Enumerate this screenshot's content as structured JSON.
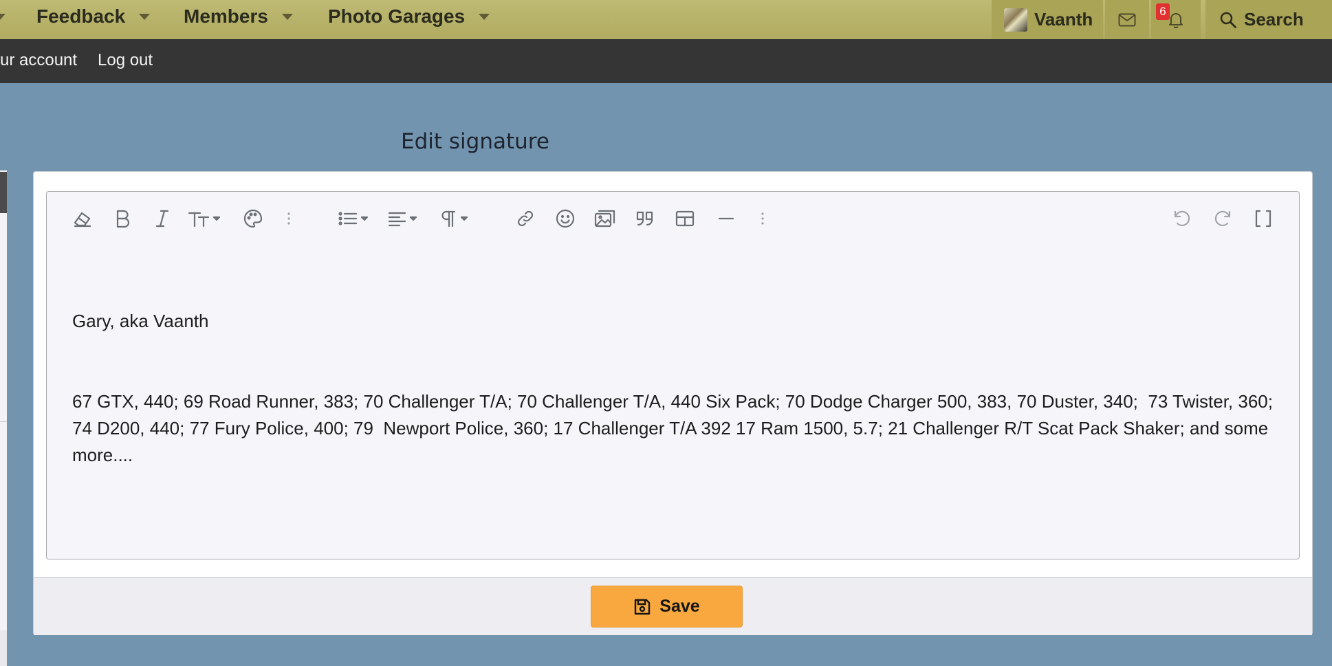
{
  "nav": {
    "items": [
      {
        "label": "Feedback"
      },
      {
        "label": "Members"
      },
      {
        "label": "Photo Garages"
      }
    ],
    "user": {
      "name": "Vaanth"
    },
    "notifications": {
      "count": "6"
    },
    "search": {
      "label": "Search"
    }
  },
  "subnav": {
    "links": [
      {
        "label": "ur account"
      },
      {
        "label": "Log out"
      }
    ]
  },
  "page": {
    "title": "Edit signature"
  },
  "editor": {
    "toolbar": [
      {
        "icon": "eraser-icon"
      },
      {
        "icon": "bold-icon"
      },
      {
        "icon": "italic-icon"
      },
      {
        "icon": "text-size-icon"
      },
      {
        "icon": "palette-icon"
      },
      {
        "icon": "more-vertical-icon"
      },
      {
        "icon": "list-icon"
      },
      {
        "icon": "align-icon"
      },
      {
        "icon": "paragraph-icon"
      },
      {
        "icon": "link-icon"
      },
      {
        "icon": "emoji-icon"
      },
      {
        "icon": "image-icon"
      },
      {
        "icon": "quote-icon"
      },
      {
        "icon": "table-icon"
      },
      {
        "icon": "horizontal-rule-icon"
      },
      {
        "icon": "more-vertical-icon"
      },
      {
        "icon": "undo-icon"
      },
      {
        "icon": "redo-icon"
      },
      {
        "icon": "bbcode-toggle-icon"
      }
    ],
    "content_line1": "Gary, aka Vaanth",
    "content_line2": "67 GTX, 440; 69 Road Runner, 383; 70 Challenger T/A; 70 Challenger T/A, 440 Six Pack; 70 Dodge Charger 500, 383, 70 Duster, 340;  73 Twister, 360; 74 D200, 440; 77 Fury Police, 400; 79  Newport Police, 360; 17 Challenger T/A 392 17 Ram 1500, 5.7; 21 Challenger R/T Scat Pack Shaker; and some more...."
  },
  "footer": {
    "save_label": "Save"
  },
  "colors": {
    "nav_bg": "#b8b36a",
    "subnav_bg": "#353535",
    "page_bg": "#7394ae",
    "save_button": "#f8a83f",
    "badge": "#e03030"
  }
}
